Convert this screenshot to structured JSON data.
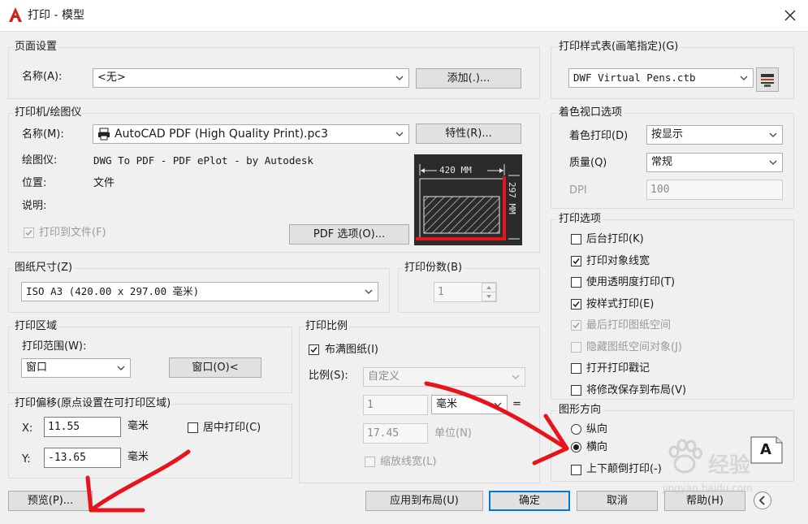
{
  "window": {
    "title": "打印 - 模型"
  },
  "page_setup": {
    "group_label": "页面设置",
    "name_label": "名称(A):",
    "name_value": "<无>",
    "add_button": "添加(.)..."
  },
  "printer": {
    "group_label": "打印机/绘图仪",
    "name_label": "名称(M):",
    "name_value": "AutoCAD PDF (High Quality Print).pc3",
    "properties_button": "特性(R)...",
    "plotter_label": "绘图仪:",
    "plotter_value": "DWG To PDF - PDF ePlot - by Autodesk",
    "location_label": "位置:",
    "location_value": "文件",
    "description_label": "说明:",
    "print_to_file_label": "打印到文件(F)",
    "pdf_options_button": "PDF 选项(O)...",
    "preview_width_text": "420 MM",
    "preview_height_text": "297 MM"
  },
  "paper_size": {
    "group_label": "图纸尺寸(Z)",
    "value": "ISO A3 (420.00 x 297.00 毫米)"
  },
  "copies": {
    "group_label": "打印份数(B)",
    "value": "1"
  },
  "plot_area": {
    "group_label": "打印区域",
    "range_label": "打印范围(W):",
    "range_value": "窗口",
    "window_button": "窗口(O)<"
  },
  "plot_offset": {
    "group_label": "打印偏移(原点设置在可打印区域)",
    "x_label": "X:",
    "x_value": "11.55",
    "y_label": "Y:",
    "y_value": "-13.65",
    "unit": "毫米",
    "center_label": "居中打印(C)"
  },
  "plot_scale": {
    "group_label": "打印比例",
    "fit_label": "布满图纸(I)",
    "scale_label": "比例(S):",
    "scale_value": "自定义",
    "value1": "1",
    "unit1": "毫米",
    "equals": "=",
    "value2": "17.45",
    "unit2": "单位(N)",
    "lineweights_label": "缩放线宽(L)"
  },
  "style_table": {
    "group_label": "打印样式表(画笔指定)(G)",
    "value": "DWF Virtual Pens.ctb"
  },
  "shaded_viewport": {
    "group_label": "着色视口选项",
    "shade_label": "着色打印(D)",
    "shade_value": "按显示",
    "quality_label": "质量(Q)",
    "quality_value": "常规",
    "dpi_label": "DPI",
    "dpi_value": "100"
  },
  "plot_options": {
    "group_label": "打印选项",
    "items": [
      {
        "label": "后台打印(K)",
        "checked": false,
        "enabled": true
      },
      {
        "label": "打印对象线宽",
        "checked": true,
        "enabled": true
      },
      {
        "label": "使用透明度打印(T)",
        "checked": false,
        "enabled": true
      },
      {
        "label": "按样式打印(E)",
        "checked": true,
        "enabled": true
      },
      {
        "label": "最后打印图纸空间",
        "checked": true,
        "enabled": false
      },
      {
        "label": "隐藏图纸空间对象(J)",
        "checked": false,
        "enabled": false
      },
      {
        "label": "打开打印戳记",
        "checked": false,
        "enabled": true
      },
      {
        "label": "将修改保存到布局(V)",
        "checked": false,
        "enabled": true
      }
    ]
  },
  "orientation": {
    "group_label": "图形方向",
    "portrait_label": "纵向",
    "landscape_label": "横向",
    "upside_down_label": "上下颠倒打印(-)",
    "selected": "landscape",
    "icon_letter": "A"
  },
  "bottom": {
    "preview_button": "预览(P)...",
    "apply_button": "应用到布局(U)",
    "ok_button": "确定",
    "cancel_button": "取消",
    "help_button": "帮助(H)"
  },
  "watermark": {
    "brand": "经验",
    "url": "jingyan.baidu.com"
  },
  "colors": {
    "accent": "#0078d7",
    "annotation_red": "#e8141b"
  }
}
